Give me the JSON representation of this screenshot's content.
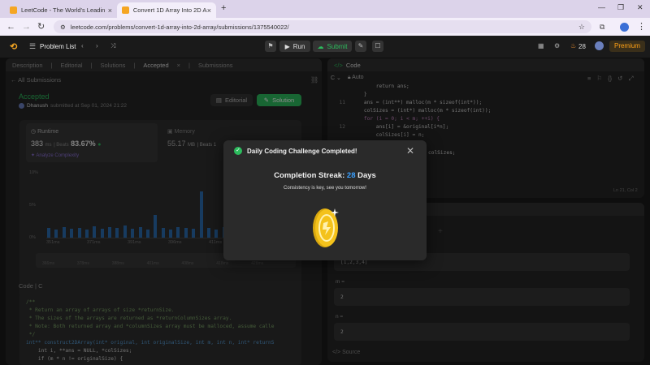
{
  "browser": {
    "tabs": [
      {
        "title": "LeetCode - The World's Leadin"
      },
      {
        "title": "Convert 1D Array Into 2D Array"
      }
    ],
    "new_tab": "+",
    "url": "leetcode.com/problems/convert-1d-array-into-2d-array/submissions/1375540022/"
  },
  "nav": {
    "problem_list": "Problem List",
    "run": "Run",
    "submit": "Submit",
    "streak_count": "28",
    "premium": "Premium"
  },
  "left_tabs": [
    "Description",
    "Editorial",
    "Solutions",
    "Accepted",
    "Submissions"
  ],
  "all_submissions": "All Submissions",
  "submission": {
    "status": "Accepted",
    "user": "Dhanush",
    "submitted_text": "submitted at Sep 01, 2024 21:22",
    "editorial_btn": "Editorial",
    "solution_btn": "Solution"
  },
  "stats": {
    "runtime_label": "Runtime",
    "runtime_value": "383",
    "runtime_unit": "ms",
    "beats_label": "Beats",
    "beats_value": "83.67%",
    "analyze": "Analyze Complexity",
    "memory_label": "Memory",
    "memory_value": "55.17",
    "memory_unit": "MB",
    "memory_beats": "Beats 1"
  },
  "chart_data": {
    "type": "bar",
    "ylabels": [
      "10%",
      "5%",
      "0%"
    ],
    "xlabels": [
      "351ms",
      "371ms",
      "391ms",
      "396ms",
      "411ms",
      "421ms"
    ],
    "mini_xlabels": [
      "366ms",
      "378ms",
      "388ms",
      "401ms",
      "408ms",
      "418ms",
      "428ms"
    ],
    "values": [
      1.4,
      1.2,
      1.5,
      1.3,
      1.4,
      1.2,
      1.6,
      1.3,
      1.5,
      1.4,
      1.7,
      1.3,
      1.5,
      1.2,
      3.3,
      1.4,
      1.2,
      1.5,
      1.4,
      1.3,
      6.6,
      1.4,
      1.2,
      1.5,
      1.4,
      3.4,
      1.3,
      2.6,
      1.2,
      1.4,
      1.3,
      1.5
    ],
    "ylim": [
      0,
      10
    ]
  },
  "code_section": {
    "label": "Code",
    "lang": "C",
    "lines": [
      "/**",
      " * Return an array of arrays of size *returnSize.",
      " * The sizes of the arrays are returned as *returnColumnSizes array.",
      " * Note: Both returned array and *columnSizes array must be malloced, assume calle",
      " */",
      "int** construct2DArray(int* original, int originalSize, int m, int n, int* returnS",
      "    int i, **ans = NULL, *colSizes;",
      "    if (m * n != originalSize) {"
    ]
  },
  "editor": {
    "title": "Code",
    "lang": "C",
    "auto": "Auto",
    "line_numbers": [
      "11",
      "12",
      "13",
      "14",
      "15",
      "16",
      "17",
      "18"
    ],
    "lines": [
      "        return ans;",
      "    }",
      "    ans = (int**) malloc(m * sizeof(int*));",
      "    colSizes = (int*) malloc(m * sizeof(int));",
      "    for (i = 0; i < m; ++i) {",
      "        ans[i] = &original[i*n];",
      "        colSizes[i] = n;",
      "    }"
    ],
    "tail": "colSizes;",
    "cursor": "Ln 21, Col 2"
  },
  "testcase": {
    "case_value": "[1,2,3,4]",
    "m_label": "m =",
    "m_value": "2",
    "n_label": "n =",
    "n_value": "2",
    "source": "Source"
  },
  "modal": {
    "title": "Daily Coding Challenge Completed!",
    "streak_label": "Completion Streak:",
    "streak_value": "28",
    "streak_unit": "Days",
    "subtitle": "Consistency is key, see you tomorrow!"
  },
  "colors": {
    "accent_green": "#2cbb5d",
    "streak_blue": "#3aa0ff",
    "coin": "#f4c21b"
  }
}
